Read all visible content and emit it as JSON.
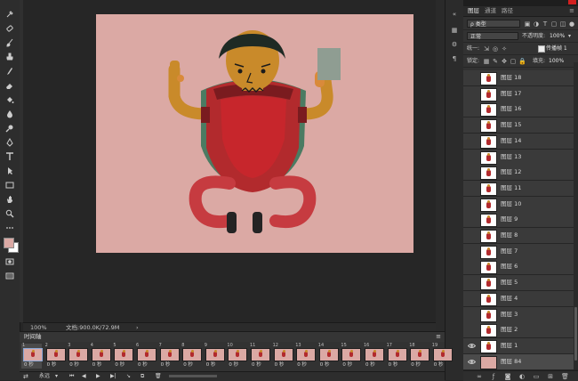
{
  "canvas": {
    "background": "#dba9a4"
  },
  "status": {
    "zoom": "100%",
    "doc_info": "文档:900.0K/72.9M",
    "arrow": "›"
  },
  "timeline": {
    "title": "时间轴",
    "first_delay": "0 秒",
    "delay_label": "0 秒",
    "loop_label": "永远",
    "frame_numbers": [
      "1",
      "2",
      "3",
      "4",
      "5",
      "6",
      "7",
      "8",
      "9",
      "10",
      "11",
      "12",
      "13",
      "14",
      "15",
      "16",
      "17",
      "18",
      "19"
    ]
  },
  "panel": {
    "tabs": [
      {
        "label": "图层"
      },
      {
        "label": "通道"
      },
      {
        "label": "路径"
      }
    ],
    "filter_label": "ρ 类型",
    "blend_mode": "正常",
    "opacity_label": "不透明度:",
    "opacity_value": "100%",
    "unify_label": "统一:",
    "propagate_label": "传播帧 1",
    "lock_label": "锁定:",
    "fill_label": "填充:",
    "fill_value": "100%",
    "layers": [
      {
        "name": "图层 18",
        "visible": false
      },
      {
        "name": "图层 17",
        "visible": false
      },
      {
        "name": "图层 16",
        "visible": false
      },
      {
        "name": "图层 15",
        "visible": false
      },
      {
        "name": "图层 14",
        "visible": false
      },
      {
        "name": "图层 13",
        "visible": false
      },
      {
        "name": "图层 12",
        "visible": false
      },
      {
        "name": "图层 11",
        "visible": false
      },
      {
        "name": "图层 10",
        "visible": false
      },
      {
        "name": "图层 9",
        "visible": false
      },
      {
        "name": "图层 8",
        "visible": false
      },
      {
        "name": "图层 7",
        "visible": false
      },
      {
        "name": "图层 6",
        "visible": false
      },
      {
        "name": "图层 5",
        "visible": false
      },
      {
        "name": "图层 4",
        "visible": false
      },
      {
        "name": "图层 3",
        "visible": false
      },
      {
        "name": "图层 2",
        "visible": false
      },
      {
        "name": "图层 1",
        "visible": true
      },
      {
        "name": "图层 84",
        "visible": true,
        "selected": true
      }
    ]
  },
  "tools": [
    {
      "icon": "eyedropper-icon"
    },
    {
      "icon": "healing-brush-icon"
    },
    {
      "icon": "brush-icon"
    },
    {
      "icon": "clone-stamp-icon"
    },
    {
      "icon": "history-brush-icon"
    },
    {
      "icon": "eraser-icon"
    },
    {
      "icon": "paint-bucket-icon"
    },
    {
      "icon": "blur-icon"
    },
    {
      "icon": "dodge-icon"
    },
    {
      "icon": "pen-icon"
    },
    {
      "icon": "type-icon"
    },
    {
      "icon": "path-select-icon"
    },
    {
      "icon": "rectangle-icon"
    },
    {
      "icon": "hand-icon"
    },
    {
      "icon": "zoom-icon"
    },
    {
      "icon": "more-tools-icon"
    }
  ],
  "colors": {
    "foreground": "#dba9a4",
    "background": "#ffffff",
    "accent": "#8aa8d8",
    "eye_open": "#c6c6c6"
  }
}
